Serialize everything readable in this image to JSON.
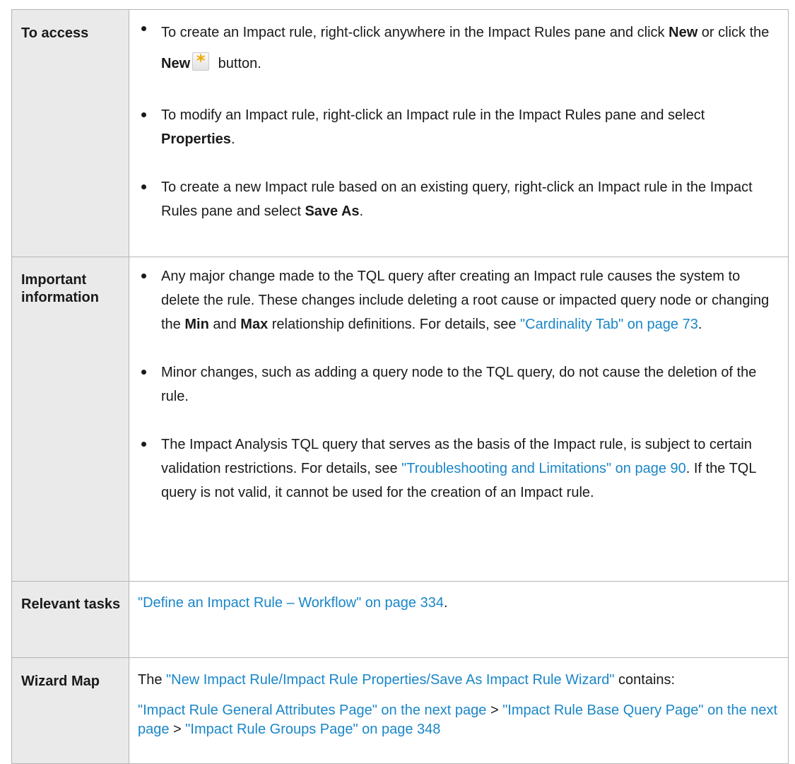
{
  "table": {
    "access": {
      "label": "To access",
      "items": [
        {
          "t1": "To create an Impact rule, right-click anywhere in the Impact Rules pane and click ",
          "b1": "New",
          "t2": " or click the ",
          "b2": "New",
          "icon": "new-asterisk-icon",
          "t3": " button."
        },
        {
          "t1": "To modify an Impact rule, right-click an Impact rule in the Impact Rules pane and select ",
          "b1": "Properties",
          "t2": "."
        },
        {
          "t1": "To create a new Impact rule based on an existing query, right-click an Impact rule in the Impact Rules pane and select ",
          "b1": "Save As",
          "t2": "."
        }
      ]
    },
    "important": {
      "label": "Important information",
      "items": [
        {
          "t1": "Any major change made to the TQL query after creating an Impact rule causes the system to delete the rule. These changes include deleting a root cause or impacted query node or changing the ",
          "b1": "Min",
          "t2": " and ",
          "b2": "Max",
          "t3": " relationship definitions. For details, see ",
          "link1": "\"Cardinality Tab\" on page 73",
          "t4": "."
        },
        {
          "t1": "Minor changes, such as adding a query node to the TQL query, do not cause the deletion of the rule."
        },
        {
          "t1": "The Impact Analysis TQL query that serves as the basis of the Impact rule, is subject to certain validation restrictions. For details, see ",
          "link1": "\"Troubleshooting and Limitations\" on page 90",
          "t2": ". If the TQL query is not valid, it cannot be used for the creation of an Impact rule."
        }
      ]
    },
    "tasks": {
      "label": "Relevant tasks",
      "link1": "\"Define an Impact Rule – Workflow\" on page 334",
      "t1": "."
    },
    "wizard": {
      "label": "Wizard Map",
      "p1_t1": "The ",
      "p1_link": "\"New Impact Rule/Impact Rule Properties/Save As Impact Rule Wizard\"",
      "p1_t2": " contains:",
      "p2_link1": "\"Impact Rule General Attributes Page\" on the next page",
      "sep1": " > ",
      "p2_link2": "\"Impact Rule Base Query Page\" on the next page",
      "sep2": " > ",
      "p2_link3": "\"Impact Rule Groups Page\" on page 348"
    }
  },
  "colors": {
    "link": "#1a86c8",
    "header_bg": "#eaeaea",
    "border": "#b5b5b5",
    "icon_asterisk": "#f2a900"
  }
}
